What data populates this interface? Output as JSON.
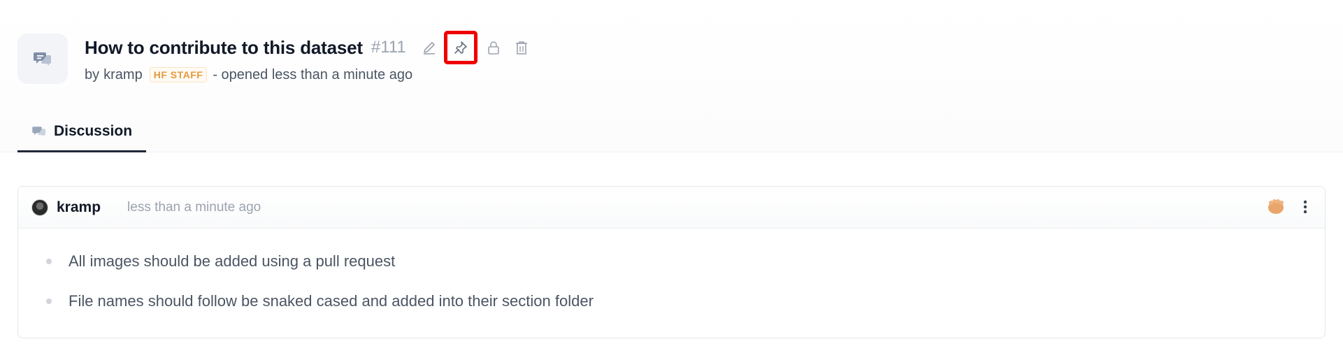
{
  "discussion": {
    "title": "How to contribute to this dataset",
    "number": "#111",
    "by_label": "by",
    "author": "kramp",
    "author_badge": "HF STAFF",
    "opened_text": "- opened less than a minute ago",
    "actions": [
      "edit-icon",
      "pin-icon",
      "lock-icon",
      "trash-icon"
    ]
  },
  "tabs": [
    {
      "label": "Discussion",
      "icon": "discussion-icon",
      "active": true
    }
  ],
  "comment": {
    "username": "kramp",
    "time": "less than a minute ago",
    "bullets": [
      "All images should be added using a pull request",
      "File names should follow be snaked cased and added into their section folder"
    ]
  },
  "colors": {
    "highlight": "#ef0000",
    "badge_text": "#e39a3d",
    "muted": "#9ca3af"
  }
}
